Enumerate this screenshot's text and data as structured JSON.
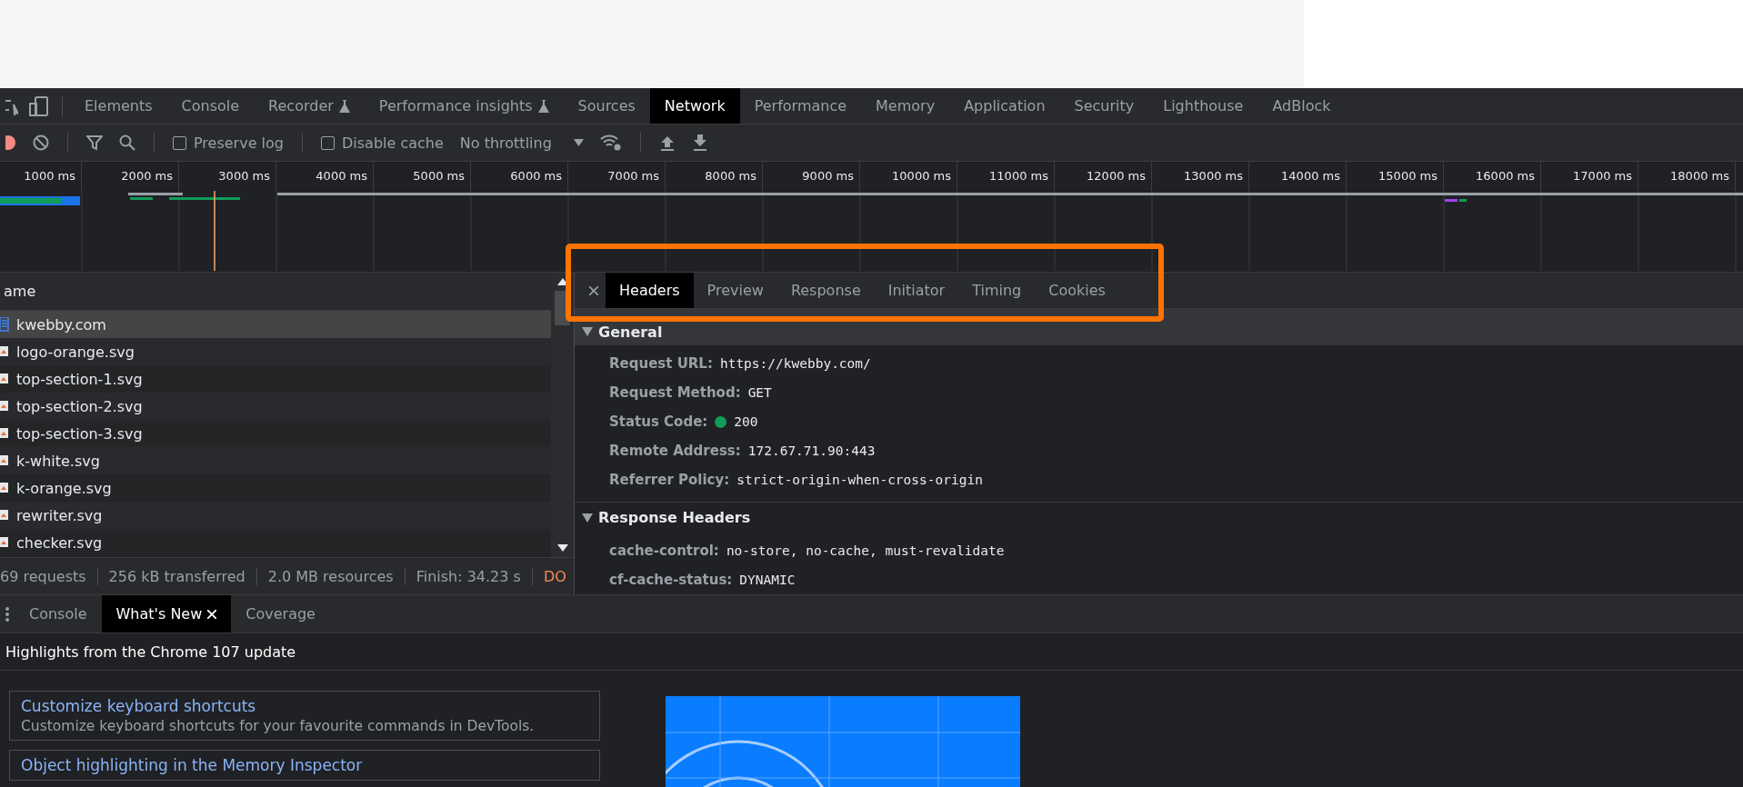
{
  "main_tabs": [
    {
      "label": "Elements",
      "selected": false,
      "experimental": false
    },
    {
      "label": "Console",
      "selected": false,
      "experimental": false
    },
    {
      "label": "Recorder",
      "selected": false,
      "experimental": true
    },
    {
      "label": "Performance insights",
      "selected": false,
      "experimental": true
    },
    {
      "label": "Sources",
      "selected": false,
      "experimental": false
    },
    {
      "label": "Network",
      "selected": true,
      "experimental": false
    },
    {
      "label": "Performance",
      "selected": false,
      "experimental": false
    },
    {
      "label": "Memory",
      "selected": false,
      "experimental": false
    },
    {
      "label": "Application",
      "selected": false,
      "experimental": false
    },
    {
      "label": "Security",
      "selected": false,
      "experimental": false
    },
    {
      "label": "Lighthouse",
      "selected": false,
      "experimental": false
    },
    {
      "label": "AdBlock",
      "selected": false,
      "experimental": false
    }
  ],
  "toolbar": {
    "preserve_log": {
      "label": "Preserve log",
      "checked": false
    },
    "disable_cache": {
      "label": "Disable cache",
      "checked": false
    },
    "throttling": "No throttling"
  },
  "timeline": {
    "ticks": [
      "1000 ms",
      "2000 ms",
      "3000 ms",
      "4000 ms",
      "5000 ms",
      "6000 ms",
      "7000 ms",
      "8000 ms",
      "9000 ms",
      "10000 ms",
      "11000 ms",
      "12000 ms",
      "13000 ms",
      "14000 ms",
      "15000 ms",
      "16000 ms",
      "17000 ms",
      "18000 ms"
    ]
  },
  "requests": {
    "column": "ame",
    "rows": [
      {
        "name": "kwebby.com",
        "kind": "document",
        "selected": true
      },
      {
        "name": "logo-orange.svg",
        "kind": "image",
        "selected": false
      },
      {
        "name": "top-section-1.svg",
        "kind": "image",
        "selected": false
      },
      {
        "name": "top-section-2.svg",
        "kind": "image",
        "selected": false
      },
      {
        "name": "top-section-3.svg",
        "kind": "image",
        "selected": false
      },
      {
        "name": "k-white.svg",
        "kind": "image",
        "selected": false
      },
      {
        "name": "k-orange.svg",
        "kind": "image",
        "selected": false
      },
      {
        "name": "rewriter.svg",
        "kind": "image",
        "selected": false
      },
      {
        "name": "checker.svg",
        "kind": "image",
        "selected": false
      }
    ]
  },
  "summary": [
    {
      "text": "69 requests",
      "kind": "stat"
    },
    {
      "text": "256 kB transferred",
      "kind": "stat"
    },
    {
      "text": "2.0 MB resources",
      "kind": "stat"
    },
    {
      "text": "Finish: 34.23 s",
      "kind": "stat"
    },
    {
      "text": "DO",
      "kind": "dom"
    }
  ],
  "details": {
    "tabs": [
      {
        "label": "Headers",
        "selected": true
      },
      {
        "label": "Preview",
        "selected": false
      },
      {
        "label": "Response",
        "selected": false
      },
      {
        "label": "Initiator",
        "selected": false
      },
      {
        "label": "Timing",
        "selected": false
      },
      {
        "label": "Cookies",
        "selected": false
      }
    ],
    "sections": [
      {
        "title": "General",
        "expanded": true,
        "rows": [
          {
            "key": "Request URL:",
            "value": "https://kwebby.com/",
            "kind": "plain"
          },
          {
            "key": "Request Method:",
            "value": "GET",
            "kind": "plain"
          },
          {
            "key": "Status Code:",
            "value": "200",
            "kind": "status"
          },
          {
            "key": "Remote Address:",
            "value": "172.67.71.90:443",
            "kind": "plain"
          },
          {
            "key": "Referrer Policy:",
            "value": "strict-origin-when-cross-origin",
            "kind": "plain"
          }
        ]
      },
      {
        "title": "Response Headers",
        "expanded": true,
        "rows": [
          {
            "key": "cache-control:",
            "value": "no-store, no-cache, must-revalidate",
            "kind": "plain"
          },
          {
            "key": "cf-cache-status:",
            "value": "DYNAMIC",
            "kind": "plain"
          }
        ]
      }
    ]
  },
  "drawer": {
    "tabs": [
      {
        "label": "Console",
        "selected": false,
        "closable": false
      },
      {
        "label": "What's New",
        "selected": true,
        "closable": true
      },
      {
        "label": "Coverage",
        "selected": false,
        "closable": false
      }
    ],
    "heading": "Highlights from the Chrome 107 update",
    "features": [
      {
        "title": "Customize keyboard shortcuts",
        "description": "Customize keyboard shortcuts for your favourite commands in DevTools."
      },
      {
        "title": "Object highlighting in the Memory Inspector"
      }
    ]
  }
}
